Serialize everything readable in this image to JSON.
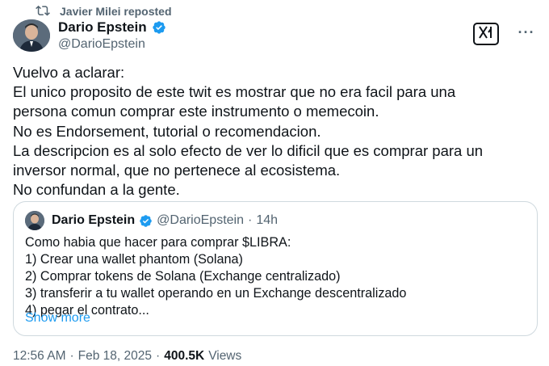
{
  "repost": {
    "icon": "repost-icon",
    "text": "Javier Milei reposted"
  },
  "author": {
    "name": "Dario Epstein",
    "handle": "@DarioEpstein",
    "verified_icon": "verified-badge-icon"
  },
  "actions": {
    "grok_icon": "grok-icon",
    "more_icon": "more-options-icon",
    "more_label": "···"
  },
  "tweet": {
    "lines": [
      "Vuelvo a aclarar:",
      "El unico proposito de este twit es mostrar que no era facil para una",
      "persona comun comprar este instrumento o memecoin.",
      "No es Endorsement, tutorial o recomendacion.",
      "La descripcion es al solo efecto de ver lo dificil que es comprar para un",
      "inversor normal, que no pertenece al ecosistema.",
      "No confundan a la gente."
    ]
  },
  "quote": {
    "name": "Dario Epstein",
    "handle": "@DarioEpstein",
    "separator": "·",
    "time": "14h",
    "lines": [
      "Como habia que hacer para comprar $LIBRA:",
      "1) Crear una wallet phantom (Solana)",
      "2) Comprar tokens de Solana (Exchange centralizado)",
      "3) transferir a tu wallet operando en un Exchange descentralizado",
      "4) pegar el contrato..."
    ],
    "show_more": "Show more"
  },
  "footer": {
    "time": "12:56 AM",
    "sep1": "·",
    "date": "Feb 18, 2025",
    "sep2": "·",
    "views_count": "400.5K",
    "views_label": "Views"
  },
  "colors": {
    "text": "#0f1419",
    "secondary": "#536471",
    "link": "#1d9bf0",
    "verified": "#1d9bf0",
    "border": "#cfd9de"
  }
}
